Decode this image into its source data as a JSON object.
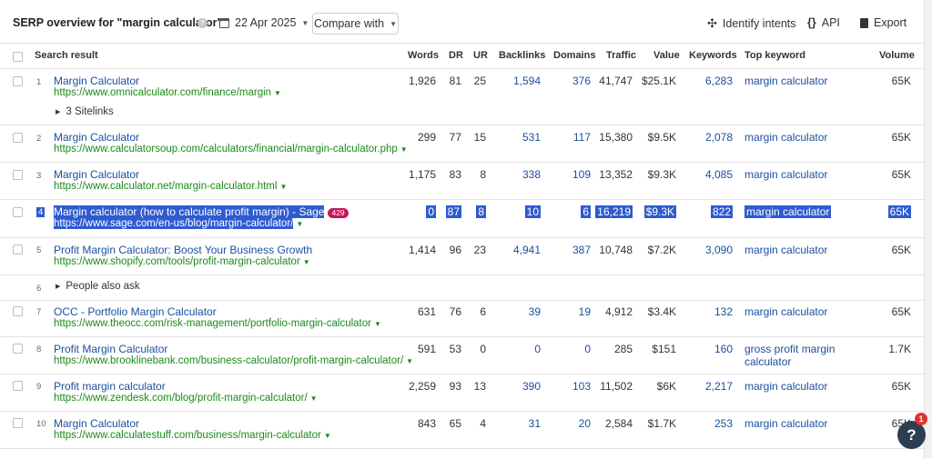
{
  "header": {
    "title": "SERP overview for \"margin calculator\"",
    "help": "?",
    "date": "22 Apr 2025",
    "compare_label": "Compare with",
    "identify_intents": "Identify intents",
    "api": "API",
    "export": "Export"
  },
  "columns": {
    "search_result": "Search result",
    "words": "Words",
    "dr": "DR",
    "ur": "UR",
    "backlinks": "Backlinks",
    "domains": "Domains",
    "traffic": "Traffic",
    "value": "Value",
    "keywords": "Keywords",
    "top_keyword": "Top keyword",
    "volume": "Volume"
  },
  "rows": [
    {
      "n": "1",
      "title": "Margin Calculator",
      "url": "https://www.omnicalculator.com/finance/margin",
      "words": "1,926",
      "dr": "81",
      "ur": "25",
      "backlinks": "1,594",
      "domains": "376",
      "traffic": "41,747",
      "value": "$25.1K",
      "keywords": "6,283",
      "top_keyword": "margin calculator",
      "volume": "65K",
      "sitelinks": "3 Sitelinks"
    },
    {
      "n": "2",
      "title": "Margin Calculator",
      "url": "https://www.calculatorsoup.com/calculators/financial/margin-calculator.php",
      "words": "299",
      "dr": "77",
      "ur": "15",
      "backlinks": "531",
      "domains": "117",
      "traffic": "15,380",
      "value": "$9.5K",
      "keywords": "2,078",
      "top_keyword": "margin calculator",
      "volume": "65K"
    },
    {
      "n": "3",
      "title": "Margin Calculator",
      "url": "https://www.calculator.net/margin-calculator.html",
      "words": "1,175",
      "dr": "83",
      "ur": "8",
      "backlinks": "338",
      "domains": "109",
      "traffic": "13,352",
      "value": "$9.3K",
      "keywords": "4,085",
      "top_keyword": "margin calculator",
      "volume": "65K"
    },
    {
      "n": "4",
      "title": "Margin calculator (how to calculate profit margin) - Sage",
      "badge": "429",
      "url": "https://www.sage.com/en-us/blog/margin-calculator/",
      "words": "0",
      "dr": "87",
      "ur": "8",
      "backlinks": "10",
      "domains": "6",
      "traffic": "16,219",
      "value": "$9.3K",
      "keywords": "822",
      "top_keyword": "margin calculator",
      "volume": "65K"
    },
    {
      "n": "5",
      "title": "Profit Margin Calculator: Boost Your Business Growth",
      "url": "https://www.shopify.com/tools/profit-margin-calculator",
      "words": "1,414",
      "dr": "96",
      "ur": "23",
      "backlinks": "4,941",
      "domains": "387",
      "traffic": "10,748",
      "value": "$7.2K",
      "keywords": "3,090",
      "top_keyword": "margin calculator",
      "volume": "65K"
    },
    {
      "n": "6",
      "people_also_ask": "People also ask"
    },
    {
      "n": "7",
      "title": "OCC - Portfolio Margin Calculator",
      "url": "https://www.theocc.com/risk-management/portfolio-margin-calculator",
      "words": "631",
      "dr": "76",
      "ur": "6",
      "backlinks": "39",
      "domains": "19",
      "traffic": "4,912",
      "value": "$3.4K",
      "keywords": "132",
      "top_keyword": "margin calculator",
      "volume": "65K"
    },
    {
      "n": "8",
      "title": "Profit Margin Calculator",
      "url": "https://www.brooklinebank.com/business-calculator/profit-margin-calculator/",
      "words": "591",
      "dr": "53",
      "ur": "0",
      "backlinks": "0",
      "domains": "0",
      "traffic": "285",
      "value": "$151",
      "keywords": "160",
      "top_keyword_l1": "gross profit margin",
      "top_keyword_l2": "calculator",
      "volume": "1.7K"
    },
    {
      "n": "9",
      "title": "Profit margin calculator",
      "url": "https://www.zendesk.com/blog/profit-margin-calculator/",
      "words": "2,259",
      "dr": "93",
      "ur": "13",
      "backlinks": "390",
      "domains": "103",
      "traffic": "11,502",
      "value": "$6K",
      "keywords": "2,217",
      "top_keyword": "margin calculator",
      "volume": "65K"
    },
    {
      "n": "10",
      "title": "Margin Calculator",
      "url": "https://www.calculatestuff.com/business/margin-calculator",
      "words": "843",
      "dr": "65",
      "ur": "4",
      "backlinks": "31",
      "domains": "20",
      "traffic": "2,584",
      "value": "$1.7K",
      "keywords": "253",
      "top_keyword": "margin calculator",
      "volume": "65K"
    }
  ],
  "fab": {
    "label": "?",
    "notifications": "1"
  }
}
